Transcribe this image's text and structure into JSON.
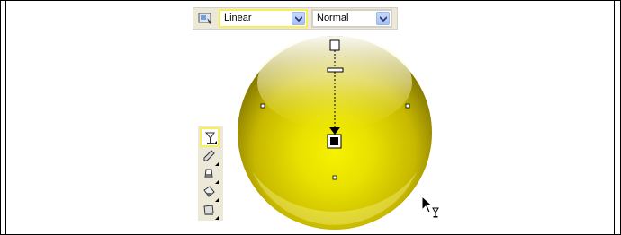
{
  "property_bar": {
    "fill_type_value": "Linear",
    "merge_mode_value": "Normal"
  },
  "icons": {
    "property_bar_tool": "interactive-fill-tool-icon",
    "dropdown_arrow": "chevron-down-icon",
    "palette": [
      "interactive-fill-tool-icon",
      "eyedropper-icon",
      "fill-bucket-icon",
      "paint-bucket-icon",
      "mesh-fill-icon"
    ],
    "cursor": "arrow-cursor-icon"
  },
  "colors": {
    "sphere_center": "#f4f000",
    "sphere_edge": "#8a7d00",
    "highlight": "#ffffff",
    "active_outline": "#f5ef5b",
    "toolbar_bg": "#ece9d8"
  }
}
